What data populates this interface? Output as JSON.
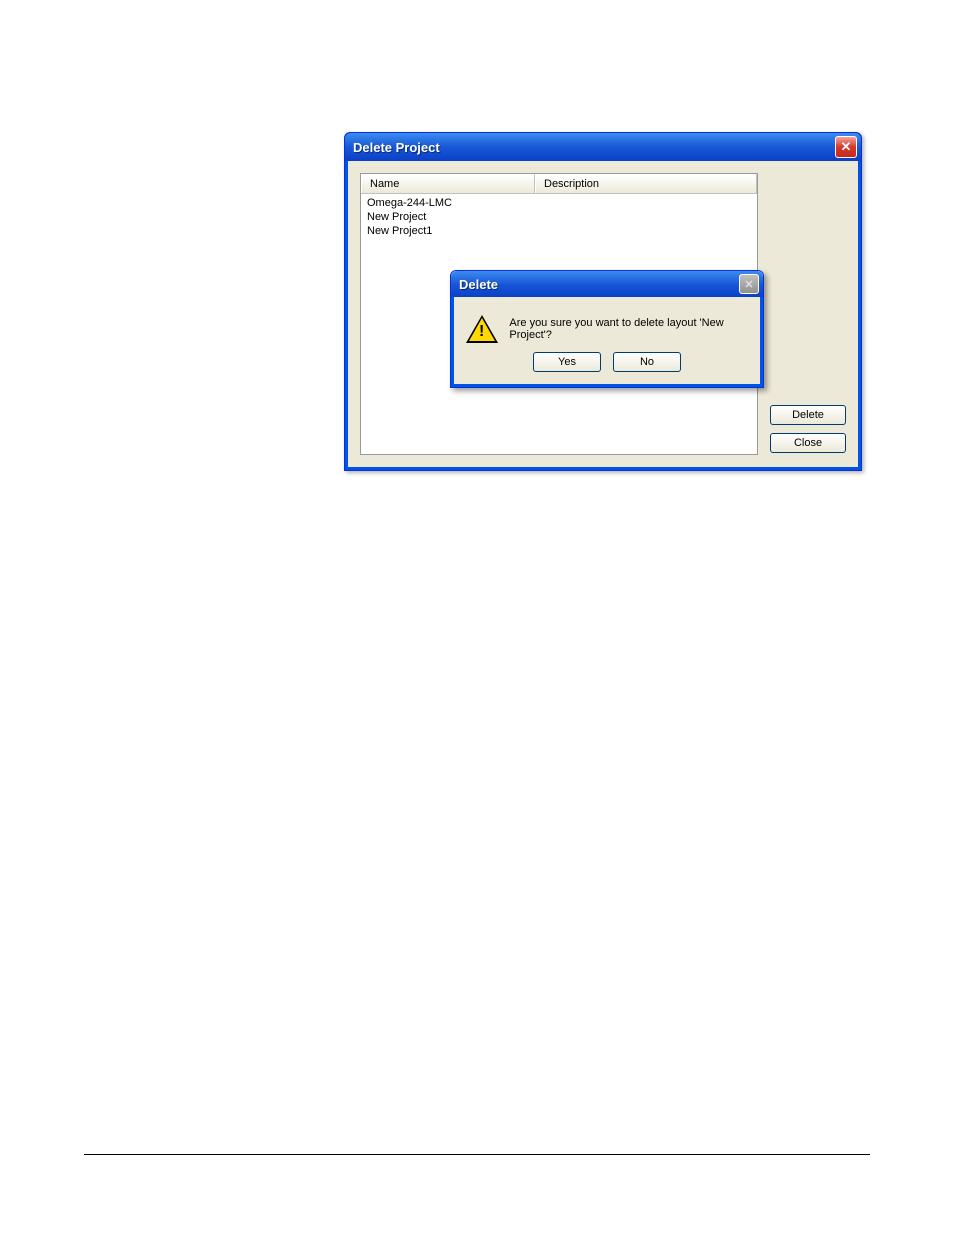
{
  "main_window": {
    "title": "Delete Project",
    "columns": {
      "name": "Name",
      "description": "Description"
    },
    "rows": [
      {
        "name": "Omega-244-LMC",
        "description": ""
      },
      {
        "name": "New Project",
        "description": ""
      },
      {
        "name": "New Project1",
        "description": ""
      }
    ],
    "buttons": {
      "delete": "Delete",
      "close": "Close"
    }
  },
  "modal": {
    "title": "Delete",
    "message": "Are you sure you want to delete layout 'New Project'?",
    "buttons": {
      "yes": "Yes",
      "no": "No"
    }
  }
}
